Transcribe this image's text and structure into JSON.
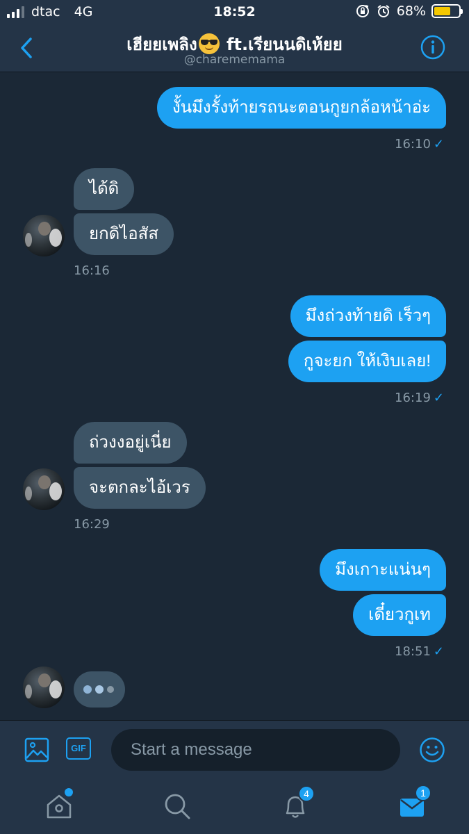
{
  "status_bar": {
    "carrier": "dtac",
    "network": "4G",
    "time": "18:52",
    "battery": "68%",
    "battery_level": 0.68
  },
  "header": {
    "title_part1": "เฮียยเพลิง",
    "title_emoji": "smiling-face-with-sunglasses",
    "title_part2": "ft.เรียนนดิเห้ยย",
    "handle": "@charememama"
  },
  "messages": [
    {
      "side": "out",
      "text": "งั้นมึงรั้งท้ายรถนะตอนกูยกล้อหน้าอ่ะ"
    },
    {
      "side": "out",
      "time": "16:10"
    },
    {
      "side": "in",
      "text": "ได้ดิ"
    },
    {
      "side": "in",
      "text": "ยกดิไอสัส"
    },
    {
      "side": "in",
      "time": "16:16"
    },
    {
      "side": "out",
      "text": "มึงถ่วงท้ายดิ เร็วๆ"
    },
    {
      "side": "out",
      "text": "กูจะยก ให้เงิบเลย!"
    },
    {
      "side": "out",
      "time": "16:19"
    },
    {
      "side": "in",
      "text": "ถ่วงงอยู่เนี่ย"
    },
    {
      "side": "in",
      "text": "จะตกละไอ้เวร"
    },
    {
      "side": "in",
      "time": "16:29"
    },
    {
      "side": "out",
      "text": "มึงเกาะแน่นๆ"
    },
    {
      "side": "out",
      "text": "เดี๋ยวกูเท"
    },
    {
      "side": "out",
      "time": "18:51"
    }
  ],
  "read_check": "✓",
  "composer": {
    "placeholder": "Start a message",
    "gif_label": "GIF"
  },
  "tabs": {
    "notifications_badge": "4",
    "messages_badge": "1"
  },
  "colors": {
    "accent": "#1da1f2",
    "background": "#1b2836",
    "bar": "#243447",
    "incoming_bubble": "#3d5466",
    "muted_text": "#8899a6"
  }
}
